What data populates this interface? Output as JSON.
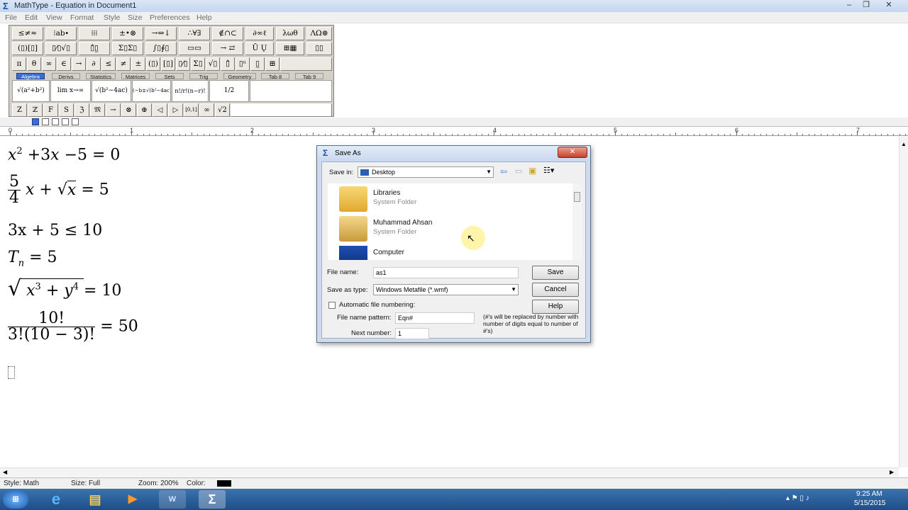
{
  "window": {
    "title": "MathType - Equation in Document1",
    "min": "‒",
    "max": "❐",
    "close": "✕"
  },
  "menu": [
    "File",
    "Edit",
    "View",
    "Format",
    "Style",
    "Size",
    "Preferences",
    "Help"
  ],
  "palette_row1": [
    "≤≠≈",
    "⁝ab∙",
    "⁞⁞⁞",
    "±•⊗",
    "→⇔↓",
    "∴∀∃",
    "∉∩⊂",
    "∂∞ℓ",
    "λωθ",
    "ΛΩ⊛"
  ],
  "palette_row2": [
    "(▯)[▯]",
    "▯⁄▯√▯",
    "▯̂▯̲",
    "Σ▯Σ▯",
    "∫▯∮▯",
    "▭▭",
    "→ ⇄",
    "Ū Ų",
    "⊞▦",
    "▯▯"
  ],
  "palette_row3": [
    "π",
    "θ",
    "∞",
    "∈",
    "→",
    "∂",
    "≤",
    "≠",
    "±",
    "(▯)",
    "[▯]",
    "▯⁄▯",
    "Σ▯",
    "√▯",
    "▯̂",
    "▯ⁿ",
    "▯̲",
    "⊞"
  ],
  "tabs": [
    "Algebra",
    "Derivs",
    "Statistics",
    "Matrices",
    "Sets",
    "Trig",
    "Geometry",
    "Tab 8",
    "Tab 9"
  ],
  "templates": [
    "√(a²+b²)",
    "lim x→∞",
    "√(b²−4ac)",
    "(−b±√(b²−4ac))/2a",
    "n!/r!(n−r)!",
    "1/2"
  ],
  "symbols_row": [
    "Z",
    "ℤ",
    "F",
    "S",
    "ℨ",
    "𝔐",
    "→",
    "⊗",
    "⊕",
    "◁",
    "▷",
    "[0,1]",
    "∞",
    "√2"
  ],
  "ruler_numbers": [
    "0",
    "1",
    "2",
    "3",
    "4",
    "5",
    "6",
    "7"
  ],
  "equations": {
    "eq1": {
      "a": "x",
      "a_sup": "2",
      "b": "+3",
      "c": "x",
      "d": "−5 = 0"
    },
    "eq2": {
      "num": "5",
      "den": "4",
      "x": "x",
      "plus": "+",
      "rad": "x",
      "rest": "= 5"
    },
    "eq3": "3x + 5 ≤ 10",
    "eq4": {
      "T": "T",
      "sub": "n",
      "rest": "= 5"
    },
    "eq5": {
      "x": "x",
      "xs": "3",
      "p": "+",
      "y": "y",
      "ys": "4",
      "rest": "= 10"
    },
    "eq6": {
      "num": "10!",
      "den": "3!(10 − 3)!",
      "rest": "= 50"
    }
  },
  "status": {
    "style": "Style: Math",
    "size": "Size: Full",
    "zoom": "Zoom: 200%",
    "color": "Color:"
  },
  "dialog": {
    "title": "Save As",
    "save_in_label": "Save in:",
    "save_in_value": "Desktop",
    "items": [
      {
        "name": "Libraries",
        "sub": "System Folder"
      },
      {
        "name": "Muhammad Ahsan",
        "sub": "System Folder"
      },
      {
        "name": "Computer",
        "sub": ""
      }
    ],
    "file_name_label": "File name:",
    "file_name_value": "as1",
    "save_type_label": "Save as type:",
    "save_type_value": "Windows Metafile (*.wmf)",
    "save": "Save",
    "cancel": "Cancel",
    "help": "Help",
    "auto_numbering": "Automatic file numbering:",
    "pattern_label": "File name pattern:",
    "pattern_value": "Eqn#",
    "pattern_note": "(#'s will be replaced by number with number of digits equal to number of #'s)",
    "next_label": "Next number:",
    "next_value": "1"
  },
  "clock": {
    "time": "9:25 AM",
    "date": "5/15/2015"
  }
}
